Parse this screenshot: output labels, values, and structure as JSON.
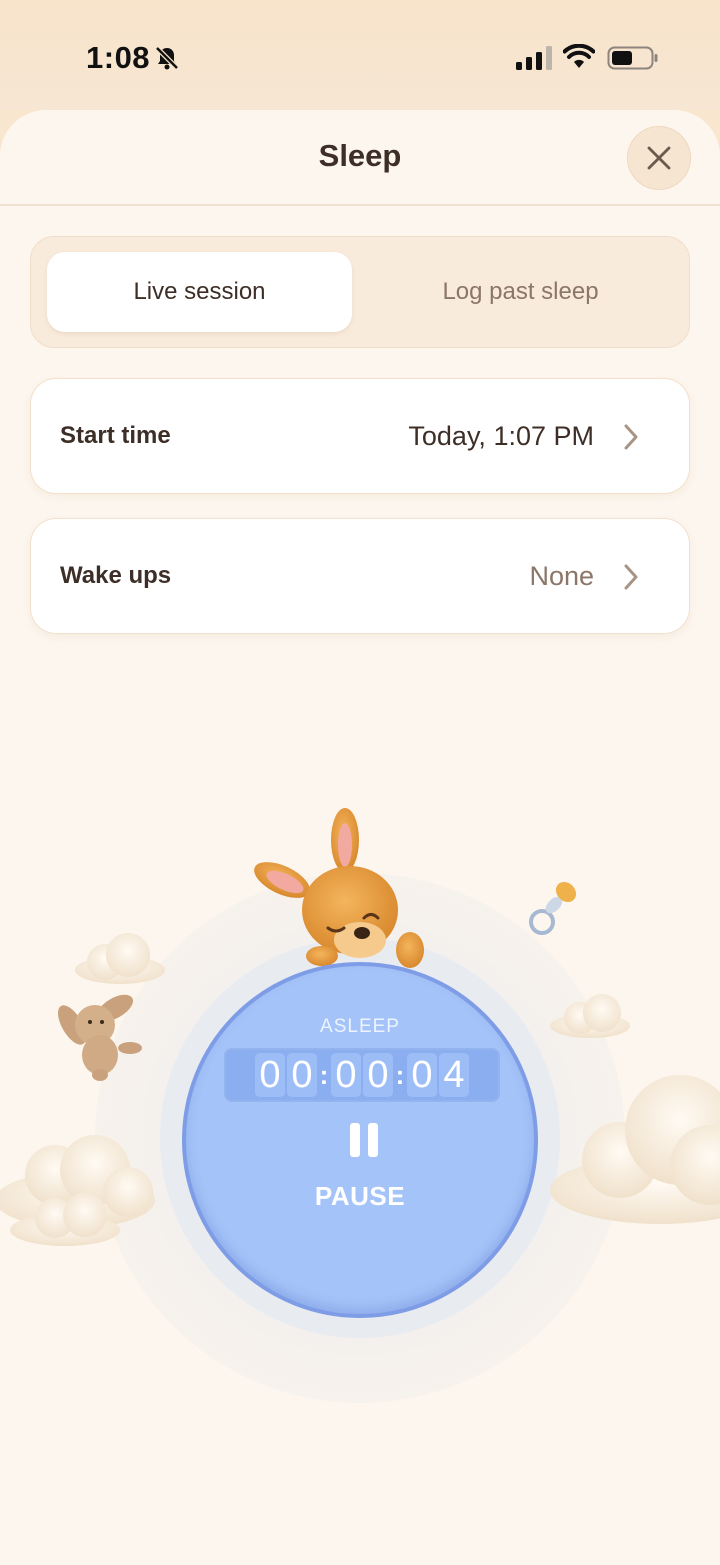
{
  "status_bar": {
    "time": "1:08",
    "icons": [
      "bell-slash-icon",
      "cellular-signal-icon",
      "wifi-icon",
      "battery-icon"
    ]
  },
  "header": {
    "title": "Sleep",
    "close_icon": "close-icon"
  },
  "segmented": {
    "options": [
      {
        "label": "Live session",
        "selected": true
      },
      {
        "label": "Log past sleep",
        "selected": false
      }
    ]
  },
  "rows": [
    {
      "label": "Start time",
      "value": "Today, 1:07 PM",
      "icon": "chevron-right-icon"
    },
    {
      "label": "Wake ups",
      "value": "None",
      "icon": "chevron-right-icon"
    }
  ],
  "timer": {
    "state": "ASLEEP",
    "digits": [
      "0",
      "0",
      "0",
      "0",
      "0",
      "4"
    ],
    "separator": ":",
    "action_label": "PAUSE",
    "action_icon": "pause-icon"
  },
  "colors": {
    "background": "#fdf6ee",
    "accent_blue": "#a4c3f8",
    "text_dark": "#3d2f27",
    "text_muted": "#8b7667"
  }
}
